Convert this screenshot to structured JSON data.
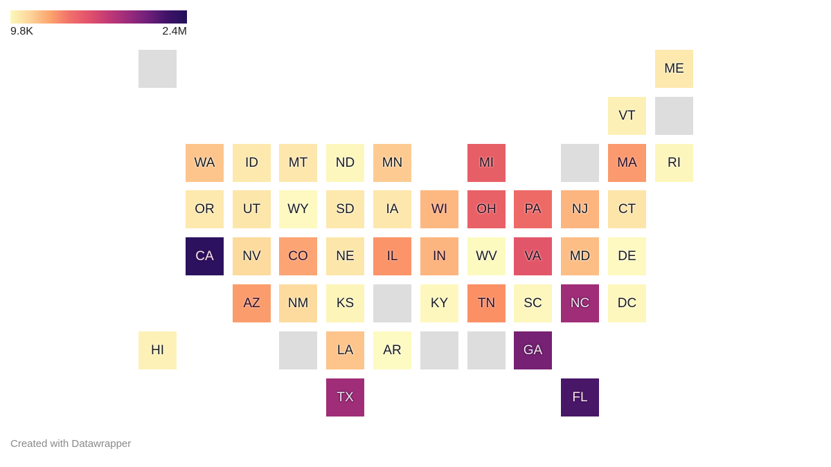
{
  "legend": {
    "min_label": "9.8K",
    "max_label": "2.4M",
    "min_value": 9800,
    "max_value": 2400000,
    "colors": [
      "#fcf8ba",
      "#fdd49a",
      "#fca56e",
      "#f1716a",
      "#e2516c",
      "#c23a75",
      "#9b2b7b",
      "#6f1f7b",
      "#3f1368",
      "#231058"
    ]
  },
  "no_data_color": "#dddddd",
  "tiles": [
    {
      "abbr": "",
      "row": 0,
      "col": 0,
      "color": "#dddddd",
      "tone": "none"
    },
    {
      "abbr": "ME",
      "row": 0,
      "col": 11,
      "color": "#fde9ae",
      "tone": "light"
    },
    {
      "abbr": "VT",
      "row": 1,
      "col": 10,
      "color": "#fdf0b6",
      "tone": "light"
    },
    {
      "abbr": "",
      "row": 1,
      "col": 11,
      "color": "#dddddd",
      "tone": "none"
    },
    {
      "abbr": "WA",
      "row": 2,
      "col": 1,
      "color": "#fdc58c",
      "tone": "light"
    },
    {
      "abbr": "ID",
      "row": 2,
      "col": 2,
      "color": "#fde8ae",
      "tone": "light"
    },
    {
      "abbr": "MT",
      "row": 2,
      "col": 3,
      "color": "#fde7ad",
      "tone": "light"
    },
    {
      "abbr": "ND",
      "row": 2,
      "col": 4,
      "color": "#fdf7bd",
      "tone": "light"
    },
    {
      "abbr": "MN",
      "row": 2,
      "col": 5,
      "color": "#fdcb91",
      "tone": "light"
    },
    {
      "abbr": "MI",
      "row": 2,
      "col": 7,
      "color": "#e65f67",
      "tone": "mid"
    },
    {
      "abbr": "",
      "row": 2,
      "col": 9,
      "color": "#dddddd",
      "tone": "none"
    },
    {
      "abbr": "MA",
      "row": 2,
      "col": 10,
      "color": "#fb9a6e",
      "tone": "mid"
    },
    {
      "abbr": "RI",
      "row": 2,
      "col": 11,
      "color": "#fdf6bc",
      "tone": "light"
    },
    {
      "abbr": "OR",
      "row": 3,
      "col": 1,
      "color": "#fde8ae",
      "tone": "light"
    },
    {
      "abbr": "UT",
      "row": 3,
      "col": 2,
      "color": "#fde6aa",
      "tone": "light"
    },
    {
      "abbr": "WY",
      "row": 3,
      "col": 3,
      "color": "#fdf9c0",
      "tone": "light"
    },
    {
      "abbr": "SD",
      "row": 3,
      "col": 4,
      "color": "#fde8ae",
      "tone": "light"
    },
    {
      "abbr": "IA",
      "row": 3,
      "col": 5,
      "color": "#fde7ad",
      "tone": "light"
    },
    {
      "abbr": "WI",
      "row": 3,
      "col": 6,
      "color": "#fdb882",
      "tone": "mid"
    },
    {
      "abbr": "OH",
      "row": 3,
      "col": 7,
      "color": "#e86167",
      "tone": "mid"
    },
    {
      "abbr": "PA",
      "row": 3,
      "col": 8,
      "color": "#ee6a67",
      "tone": "mid"
    },
    {
      "abbr": "NJ",
      "row": 3,
      "col": 9,
      "color": "#fdb57f",
      "tone": "light"
    },
    {
      "abbr": "CT",
      "row": 3,
      "col": 10,
      "color": "#fde5aa",
      "tone": "light"
    },
    {
      "abbr": "CA",
      "row": 4,
      "col": 1,
      "color": "#2c115f",
      "tone": "dark"
    },
    {
      "abbr": "NV",
      "row": 4,
      "col": 2,
      "color": "#fdda9d",
      "tone": "light"
    },
    {
      "abbr": "CO",
      "row": 4,
      "col": 3,
      "color": "#fca473",
      "tone": "mid"
    },
    {
      "abbr": "NE",
      "row": 4,
      "col": 4,
      "color": "#fde6aa",
      "tone": "light"
    },
    {
      "abbr": "IL",
      "row": 4,
      "col": 5,
      "color": "#fb9468",
      "tone": "mid"
    },
    {
      "abbr": "IN",
      "row": 4,
      "col": 6,
      "color": "#fdb57f",
      "tone": "mid"
    },
    {
      "abbr": "WV",
      "row": 4,
      "col": 7,
      "color": "#fdfac0",
      "tone": "light"
    },
    {
      "abbr": "VA",
      "row": 4,
      "col": 8,
      "color": "#e2566a",
      "tone": "mid"
    },
    {
      "abbr": "MD",
      "row": 4,
      "col": 9,
      "color": "#fdbe86",
      "tone": "light"
    },
    {
      "abbr": "DE",
      "row": 4,
      "col": 10,
      "color": "#fdf9c0",
      "tone": "light"
    },
    {
      "abbr": "AZ",
      "row": 5,
      "col": 2,
      "color": "#fb9c6c",
      "tone": "mid"
    },
    {
      "abbr": "NM",
      "row": 5,
      "col": 3,
      "color": "#fddb9e",
      "tone": "light"
    },
    {
      "abbr": "KS",
      "row": 5,
      "col": 4,
      "color": "#fdf4b9",
      "tone": "light"
    },
    {
      "abbr": "",
      "row": 5,
      "col": 5,
      "color": "#dddddd",
      "tone": "none"
    },
    {
      "abbr": "KY",
      "row": 5,
      "col": 6,
      "color": "#fdf7bd",
      "tone": "light"
    },
    {
      "abbr": "TN",
      "row": 5,
      "col": 7,
      "color": "#fb9065",
      "tone": "mid"
    },
    {
      "abbr": "SC",
      "row": 5,
      "col": 8,
      "color": "#fdf6bd",
      "tone": "light"
    },
    {
      "abbr": "NC",
      "row": 5,
      "col": 9,
      "color": "#a02d77",
      "tone": "dark"
    },
    {
      "abbr": "DC",
      "row": 5,
      "col": 10,
      "color": "#fdf7bd",
      "tone": "light"
    },
    {
      "abbr": "HI",
      "row": 6,
      "col": 0,
      "color": "#fdf1b8",
      "tone": "light"
    },
    {
      "abbr": "",
      "row": 6,
      "col": 3,
      "color": "#dddddd",
      "tone": "none"
    },
    {
      "abbr": "LA",
      "row": 6,
      "col": 4,
      "color": "#fdc48c",
      "tone": "light"
    },
    {
      "abbr": "AR",
      "row": 6,
      "col": 5,
      "color": "#fdfac2",
      "tone": "light"
    },
    {
      "abbr": "",
      "row": 6,
      "col": 6,
      "color": "#dddddd",
      "tone": "none"
    },
    {
      "abbr": "",
      "row": 6,
      "col": 7,
      "color": "#dddddd",
      "tone": "none"
    },
    {
      "abbr": "GA",
      "row": 6,
      "col": 8,
      "color": "#762173",
      "tone": "dark"
    },
    {
      "abbr": "TX",
      "row": 7,
      "col": 4,
      "color": "#a02d78",
      "tone": "dark"
    },
    {
      "abbr": "FL",
      "row": 7,
      "col": 9,
      "color": "#481768",
      "tone": "dark"
    }
  ],
  "footer": {
    "credit": "Created with Datawrapper"
  }
}
